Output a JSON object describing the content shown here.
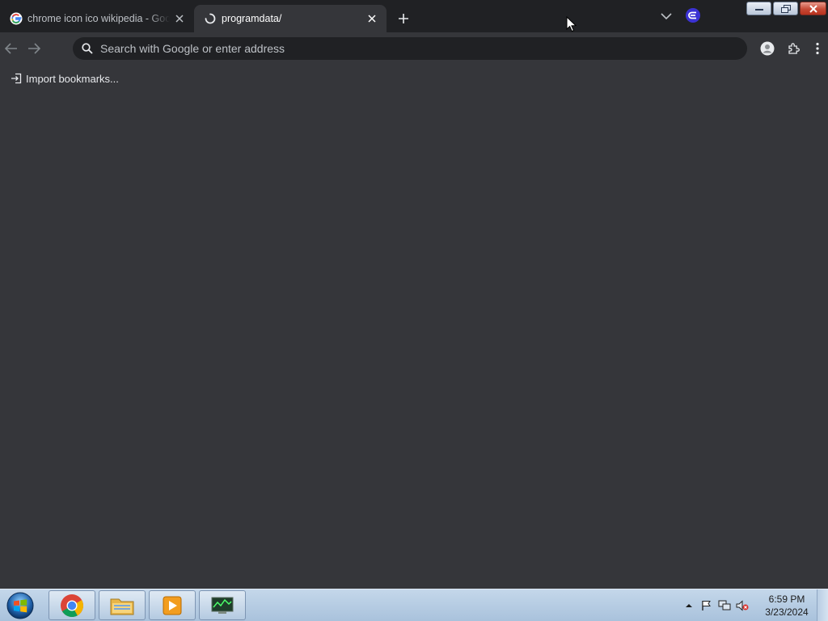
{
  "tabs": [
    {
      "title": "chrome icon ico wikipedia - Google Search",
      "state": "inactive"
    },
    {
      "title": "programdata/",
      "state": "active-loading"
    }
  ],
  "toolbar": {
    "omnibox_placeholder": "Search with Google or enter address"
  },
  "bookmarks_bar": {
    "items": [
      {
        "label": "Import bookmarks..."
      }
    ]
  },
  "taskbar": {
    "pinned_apps": [
      "chrome-icon",
      "file-explorer-icon",
      "media-player-icon",
      "network-monitor-icon"
    ],
    "clock": {
      "time": "6:59 PM",
      "date": "3/23/2024"
    }
  },
  "colors": {
    "titlebar": "#202124",
    "page": "#35363a",
    "omnibox": "#202124",
    "text": "#e8eaed"
  }
}
